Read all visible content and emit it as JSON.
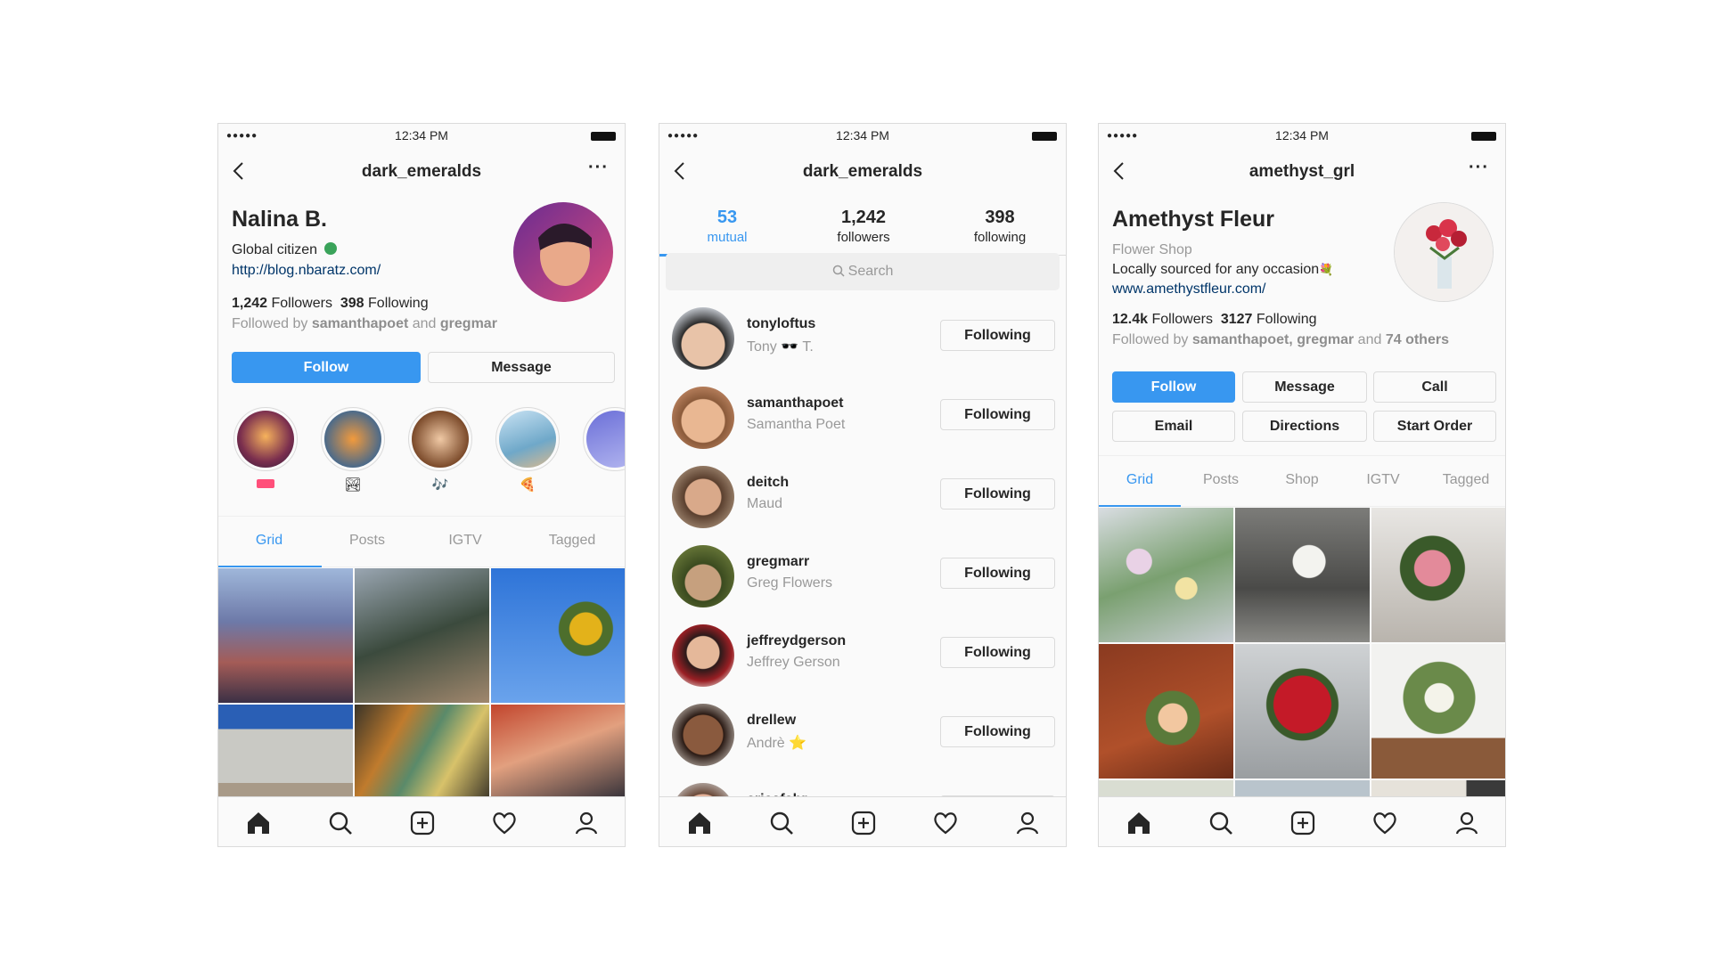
{
  "status": {
    "signal": "●●●●●",
    "time": "12:34 PM"
  },
  "phone1": {
    "username": "dark_emeralds",
    "name": "Nalina B.",
    "bio": "Global citizen",
    "link": "http://blog.nbaratz.com/",
    "followers_count": "1,242",
    "followers_label": "Followers",
    "following_count": "398",
    "following_label": "Following",
    "followed_by_prefix": "Followed by",
    "followed_by_1": "samanthapoet",
    "followed_by_and": "and",
    "followed_by_2": "gregmar",
    "follow_label": "Follow",
    "message_label": "Message",
    "tabs": [
      "Grid",
      "Posts",
      "IGTV",
      "Tagged"
    ]
  },
  "phone2": {
    "username": "dark_emeralds",
    "counts": [
      {
        "num": "53",
        "label": "mutual"
      },
      {
        "num": "1,242",
        "label": "followers"
      },
      {
        "num": "398",
        "label": "following"
      }
    ],
    "search_placeholder": "Search",
    "rows": [
      {
        "username": "tonyloftus",
        "fullname": "Tony 🕶️ T.",
        "button": "Following"
      },
      {
        "username": "samanthapoet",
        "fullname": "Samantha Poet",
        "button": "Following"
      },
      {
        "username": "deitch",
        "fullname": "Maud",
        "button": "Following"
      },
      {
        "username": "gregmarr",
        "fullname": "Greg Flowers",
        "button": "Following"
      },
      {
        "username": "jeffreydgerson",
        "fullname": "Jeffrey Gerson",
        "button": "Following"
      },
      {
        "username": "drellew",
        "fullname": "Andrè ⭐",
        "button": "Following"
      },
      {
        "username": "ericafahr",
        "fullname": "",
        "button": ""
      }
    ]
  },
  "phone3": {
    "username": "amethyst_grl",
    "name": "Amethyst Fleur",
    "category": "Flower Shop",
    "bio": "Locally sourced for any occasion",
    "link": "www.amethystfleur.com/",
    "followers_count": "12.4k",
    "followers_label": "Followers",
    "following_count": "3127",
    "following_label": "Following",
    "followed_by_prefix": "Followed by",
    "followed_by_1": "samanthapoet, gregmar",
    "followed_by_and": "and",
    "followed_by_2": "74 others",
    "buttons": [
      "Follow",
      "Message",
      "Call",
      "Email",
      "Directions",
      "Start Order"
    ],
    "tabs": [
      "Grid",
      "Posts",
      "Shop",
      "IGTV",
      "Tagged"
    ]
  },
  "icons": [
    "home-icon",
    "search-icon",
    "add-icon",
    "heart-icon",
    "profile-icon"
  ],
  "colors": {
    "accent": "#3897f0",
    "link": "#003569",
    "muted": "#999999"
  }
}
